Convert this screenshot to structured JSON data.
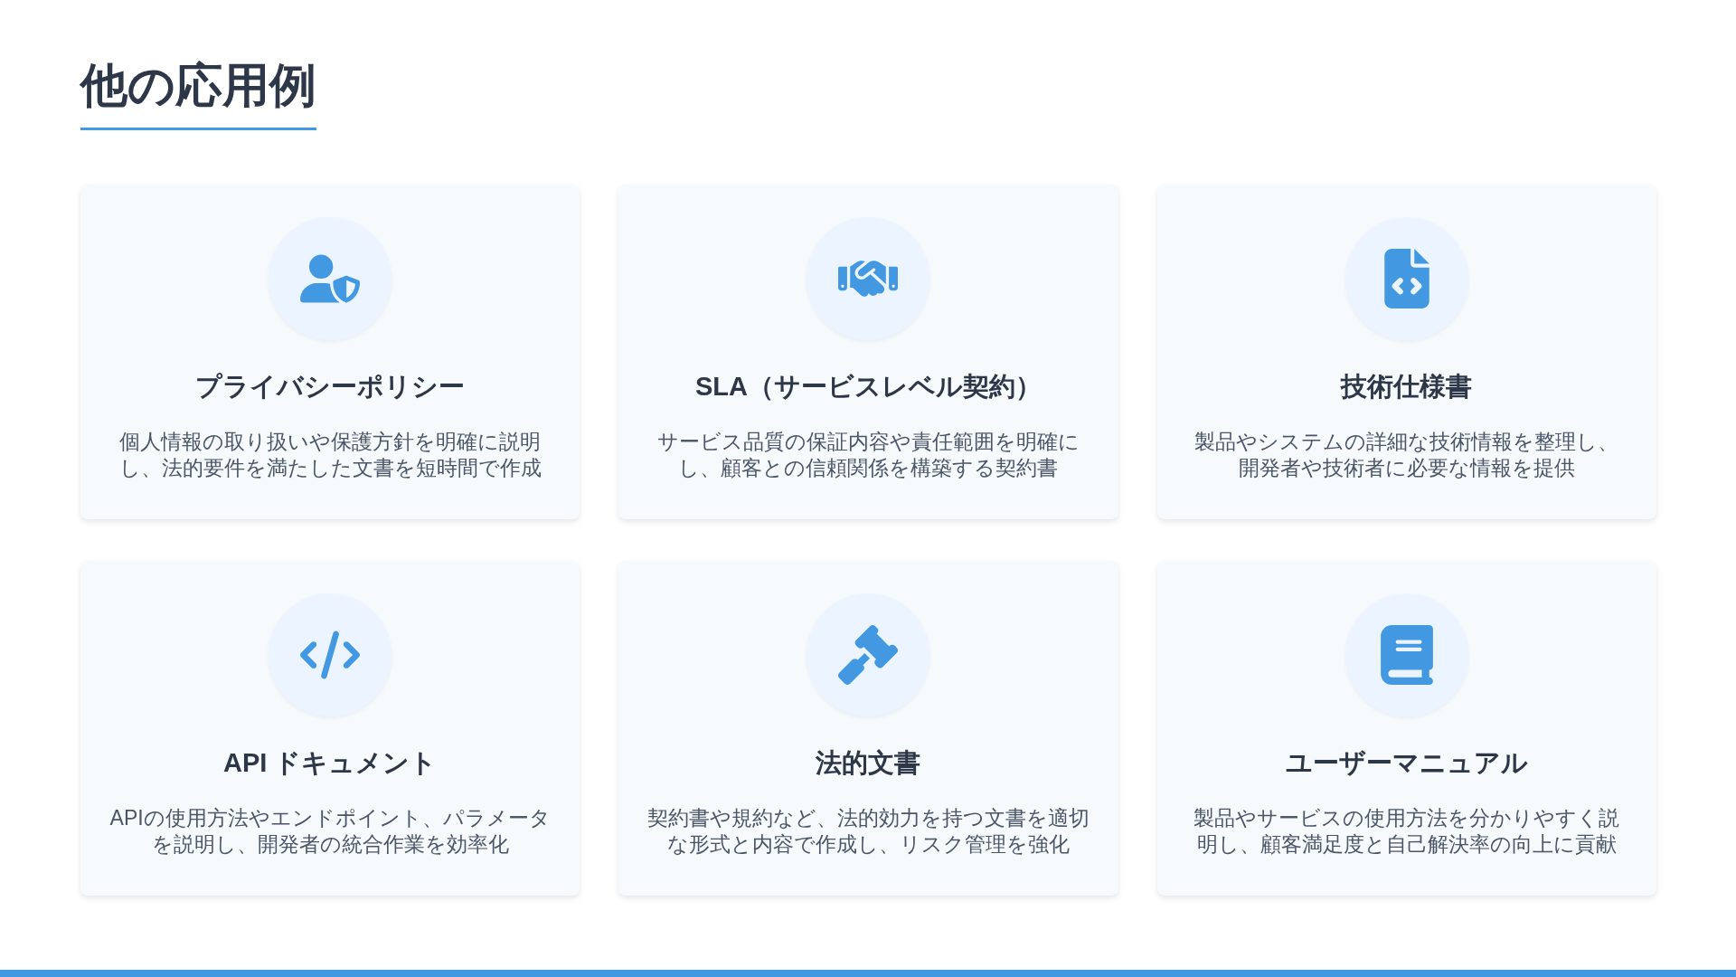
{
  "title": "他の応用例",
  "cards": [
    {
      "kind": "user-shield",
      "title": "プライバシーポリシー",
      "description": "個人情報の取り扱いや保護方針を明確に説明し、法的要件を満たした文書を短時間で作成"
    },
    {
      "kind": "handshake",
      "title": "SLA（サービスレベル契約）",
      "description": "サービス品質の保証内容や責任範囲を明確にし、顧客との信頼関係を構築する契約書"
    },
    {
      "kind": "file-code",
      "title": "技術仕様書",
      "description": "製品やシステムの詳細な技術情報を整理し、開発者や技術者に必要な情報を提供"
    },
    {
      "kind": "code",
      "title": "API ドキュメント",
      "description": "APIの使用方法やエンドポイント、パラメータを説明し、開発者の統合作業を効率化"
    },
    {
      "kind": "gavel",
      "title": "法的文書",
      "description": "契約書や規約など、法的効力を持つ文書を適切な形式と内容で作成し、リスク管理を強化"
    },
    {
      "kind": "book",
      "title": "ユーザーマニュアル",
      "description": "製品やサービスの使用方法を分かりやすく説明し、顧客満足度と自己解決率の向上に貢献"
    }
  ]
}
